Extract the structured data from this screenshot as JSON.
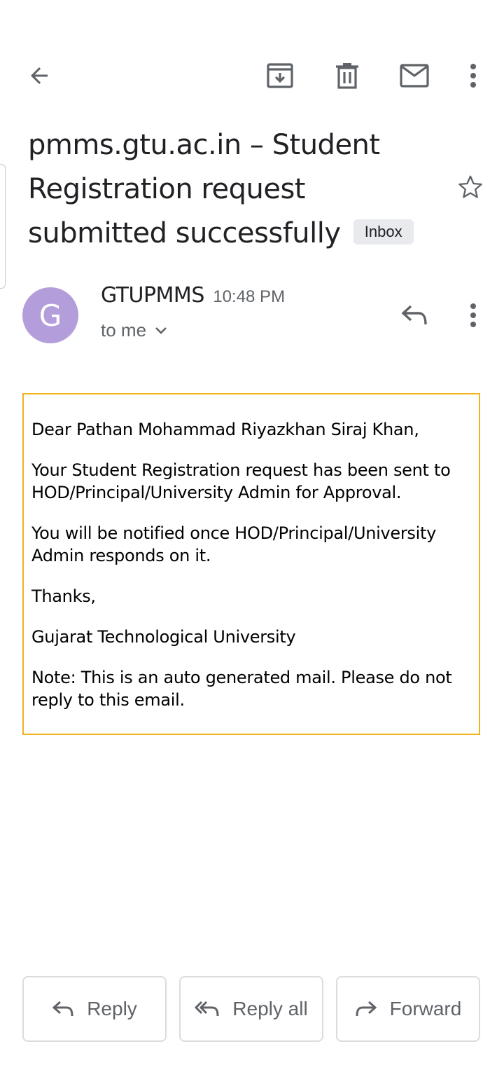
{
  "toolbar": {
    "back_icon": "arrow-back-icon",
    "archive_icon": "archive-icon",
    "delete_icon": "trash-icon",
    "mark_unread_icon": "mail-icon",
    "more_icon": "more-vert-icon"
  },
  "email": {
    "subject": "pmms.gtu.ac.in – Student Registration request submitted successfully",
    "label": "Inbox",
    "starred": false,
    "sender_name": "GTUPMMS",
    "avatar_letter": "G",
    "avatar_color": "#b39ddb",
    "time": "10:48 PM",
    "recipient": "to me",
    "body": [
      "Dear Pathan Mohammad Riyazkhan Siraj Khan,",
      "Your Student Registration request has been sent to HOD/Principal/University Admin for Approval.",
      "You will be notified once HOD/Principal/University Admin responds on it.",
      "Thanks,",
      "Gujarat Technological University",
      "Note: This is an auto generated mail. Please do not reply to this email."
    ],
    "body_border_color": "#f0b41c"
  },
  "actions": {
    "reply": "Reply",
    "reply_all": "Reply all",
    "forward": "Forward"
  }
}
